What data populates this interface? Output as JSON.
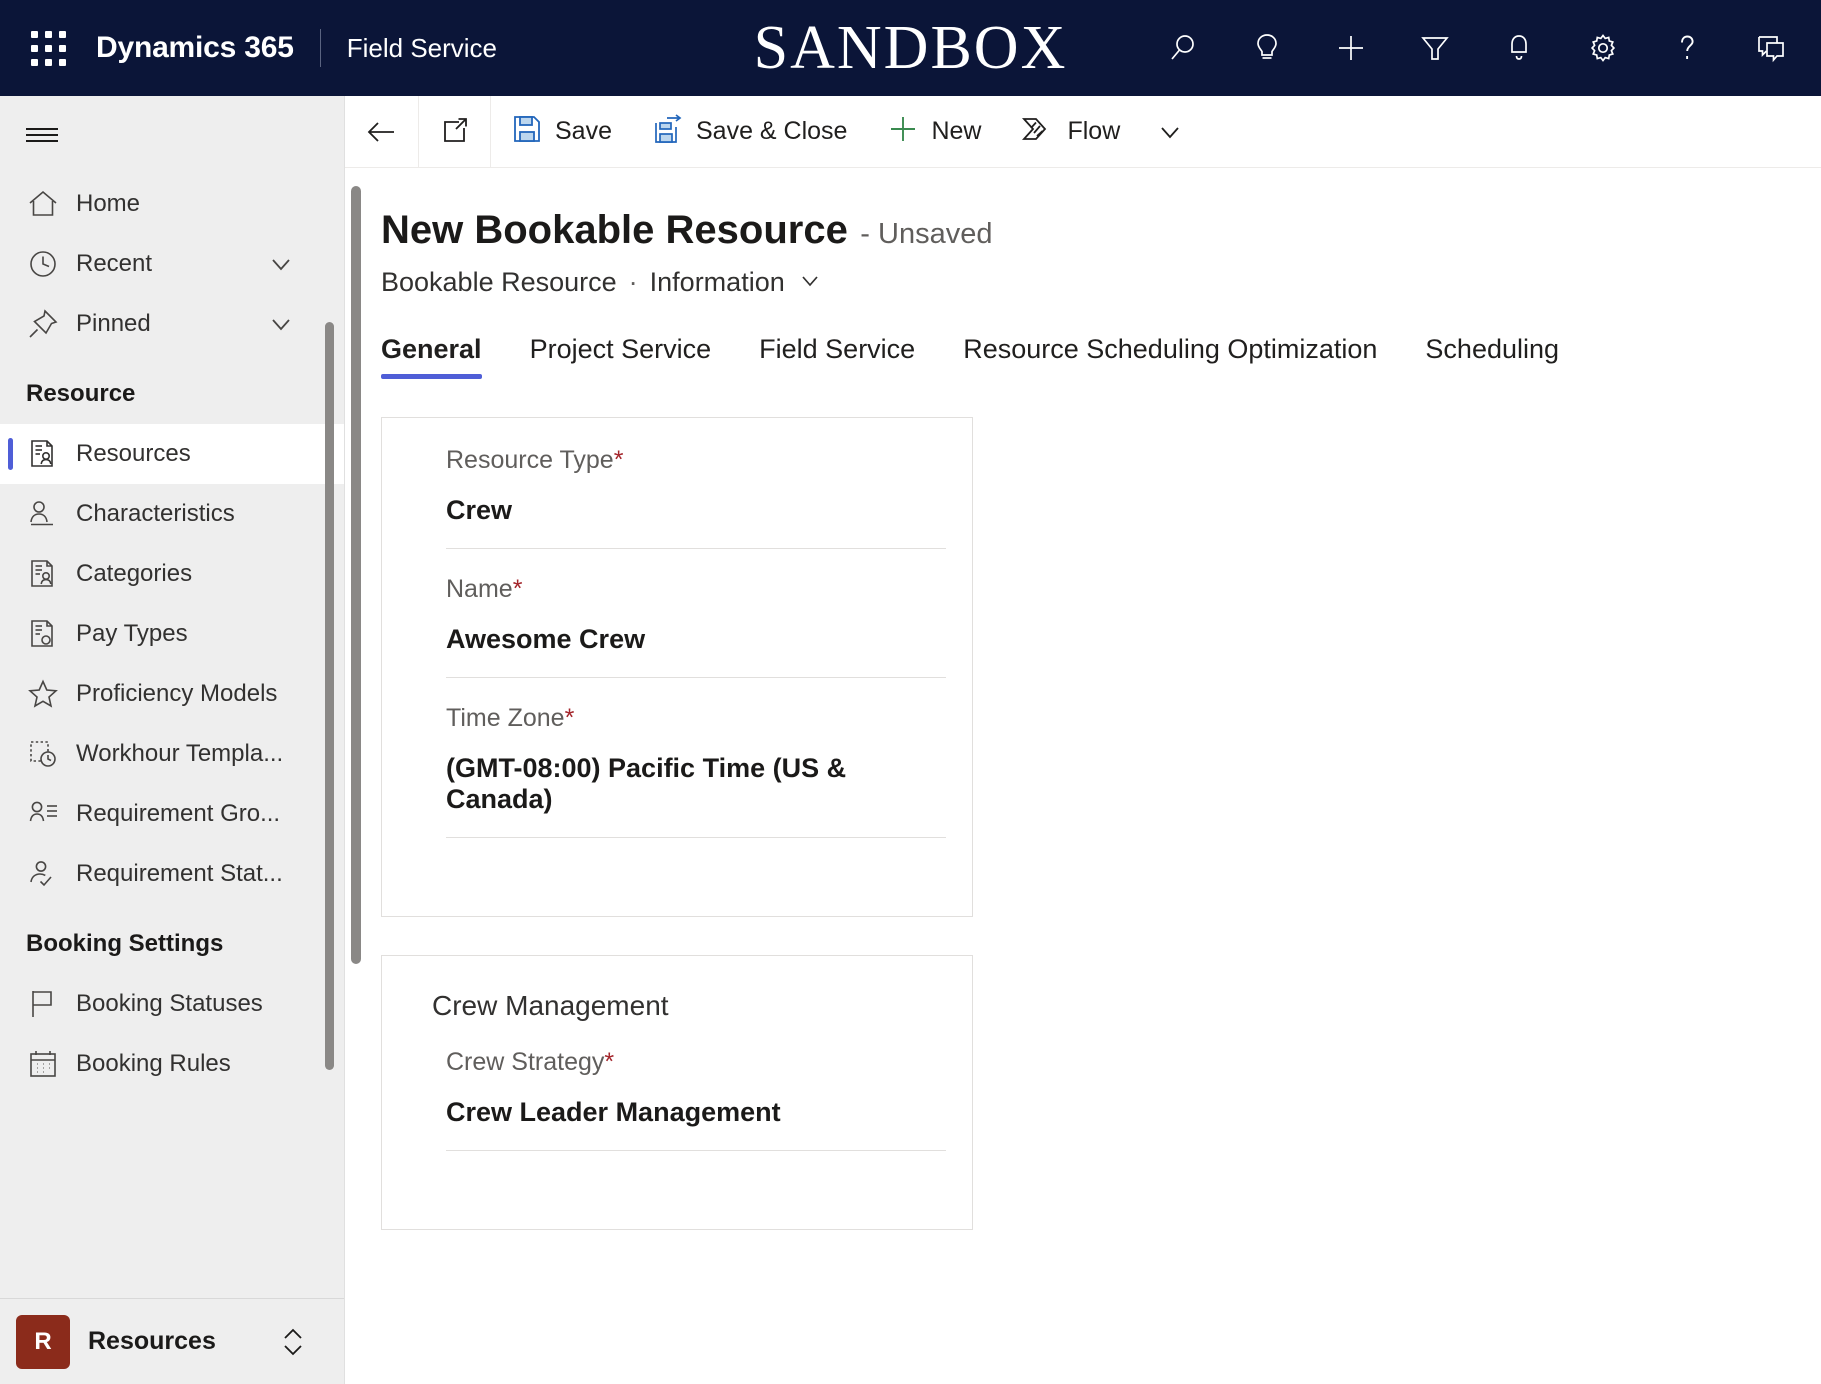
{
  "topbar": {
    "waffle_label": "app-launcher",
    "brand": "Dynamics 365",
    "app_name": "Field Service",
    "environment_banner": "SANDBOX",
    "icons": [
      {
        "name": "search-icon",
        "label": "Search"
      },
      {
        "name": "lightbulb-icon",
        "label": "Insights"
      },
      {
        "name": "plus-icon",
        "label": "Quick Create"
      },
      {
        "name": "filter-icon",
        "label": "Filter"
      },
      {
        "name": "bell-icon",
        "label": "Notifications"
      },
      {
        "name": "gear-icon",
        "label": "Settings"
      },
      {
        "name": "question-icon",
        "label": "Help"
      },
      {
        "name": "feedback-icon",
        "label": "Feedback"
      }
    ]
  },
  "sidebar": {
    "hamburger_label": "Expand navigation",
    "quick": [
      {
        "label": "Home",
        "icon": "home-icon",
        "chevron": false
      },
      {
        "label": "Recent",
        "icon": "clock-icon",
        "chevron": true
      },
      {
        "label": "Pinned",
        "icon": "pin-icon",
        "chevron": true
      }
    ],
    "groups": [
      {
        "title": "Resource",
        "items": [
          {
            "label": "Resources",
            "icon": "resource-icon",
            "selected": true
          },
          {
            "label": "Characteristics",
            "icon": "person-line-icon",
            "selected": false
          },
          {
            "label": "Categories",
            "icon": "resource-icon",
            "selected": false
          },
          {
            "label": "Pay Types",
            "icon": "pay-type-icon",
            "selected": false
          },
          {
            "label": "Proficiency Models",
            "icon": "star-icon",
            "selected": false
          },
          {
            "label": "Workhour Templa...",
            "icon": "workhour-icon",
            "selected": false
          },
          {
            "label": "Requirement Gro...",
            "icon": "requirement-group-icon",
            "selected": false
          },
          {
            "label": "Requirement Stat...",
            "icon": "requirement-status-icon",
            "selected": false
          }
        ]
      },
      {
        "title": "Booking Settings",
        "items": [
          {
            "label": "Booking Statuses",
            "icon": "flag-icon",
            "selected": false
          },
          {
            "label": "Booking Rules",
            "icon": "calendar-icon",
            "selected": false
          }
        ]
      }
    ],
    "footer": {
      "badge": "R",
      "area": "Resources",
      "switcher_icon": "area-switcher-icon"
    }
  },
  "commandbar": {
    "back_label": "Back",
    "popout_label": "Open in new window",
    "save_label": "Save",
    "save_close_label": "Save & Close",
    "new_label": "New",
    "flow_label": "Flow",
    "overflow_label": "More commands"
  },
  "record": {
    "title": "New Bookable Resource",
    "state": "- Unsaved",
    "entity": "Bookable Resource",
    "separator": "·",
    "form": "Information"
  },
  "tabs": [
    {
      "label": "General",
      "active": true
    },
    {
      "label": "Project Service",
      "active": false
    },
    {
      "label": "Field Service",
      "active": false
    },
    {
      "label": "Resource Scheduling Optimization",
      "active": false
    },
    {
      "label": "Scheduling",
      "active": false
    }
  ],
  "sections": [
    {
      "title": "",
      "fields": [
        {
          "label": "Resource Type",
          "required": true,
          "value": "Crew"
        },
        {
          "label": "Name",
          "required": true,
          "value": "Awesome Crew"
        },
        {
          "label": "Time Zone",
          "required": true,
          "value": "(GMT-08:00) Pacific Time (US & Canada)"
        }
      ]
    },
    {
      "title": "Crew Management",
      "fields": [
        {
          "label": "Crew Strategy",
          "required": true,
          "value": "Crew Leader Management"
        }
      ]
    }
  ],
  "colors": {
    "topbar_bg": "#0b1538",
    "accent": "#4f5ed7",
    "required": "#a4262c",
    "save_icon": "#2266bb",
    "new_icon": "#3a8a4f",
    "area_badge": "#8b2b1b"
  }
}
